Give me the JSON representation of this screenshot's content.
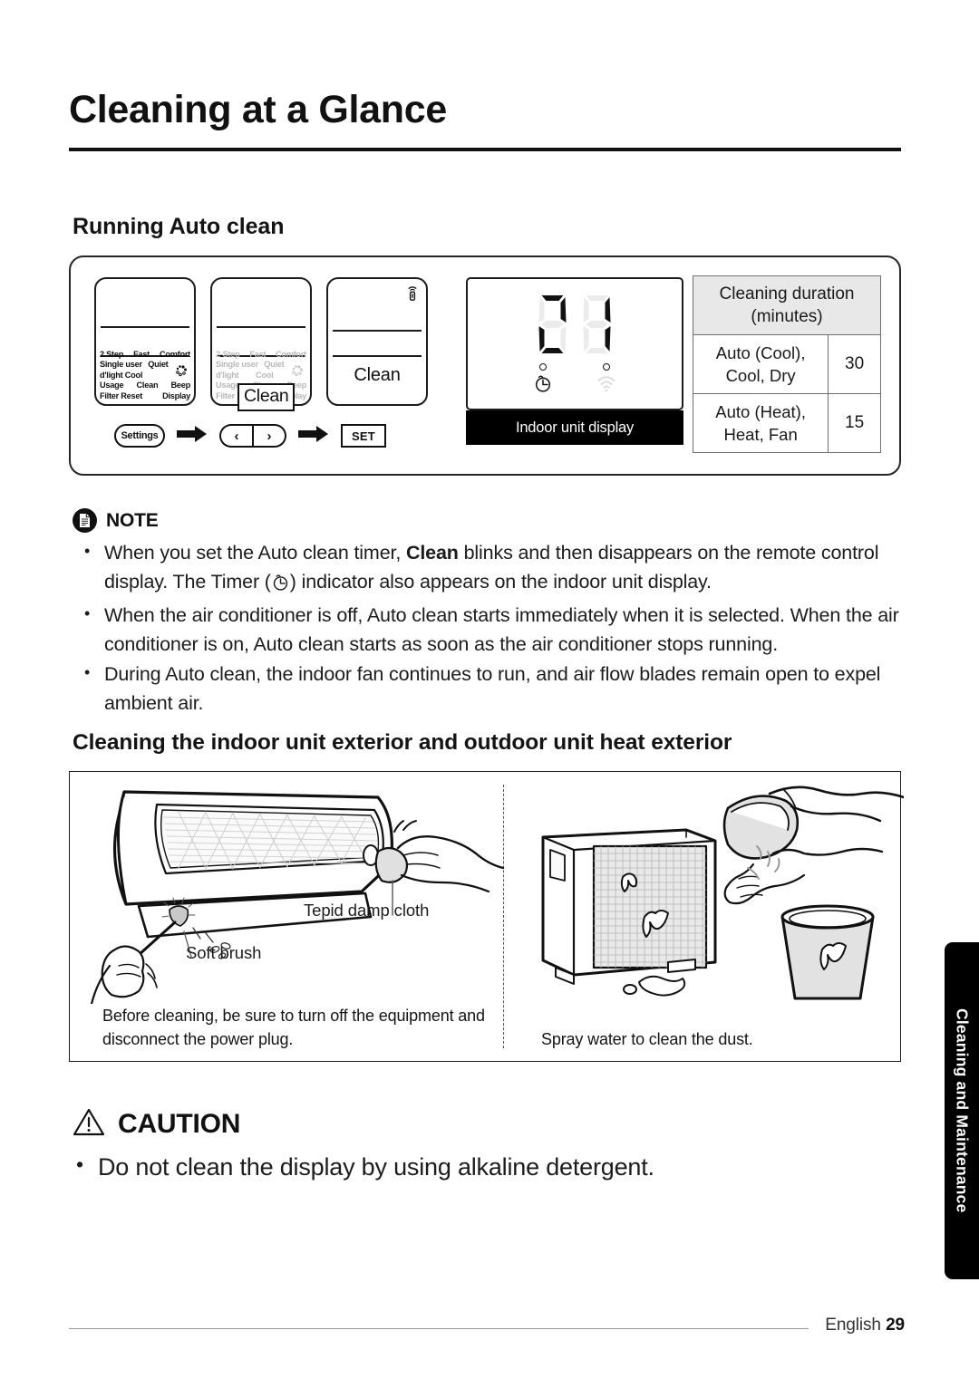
{
  "page_title": "Cleaning at a Glance",
  "sections": {
    "running_auto_clean": {
      "heading": "Running Auto clean",
      "remote_screens": [
        {
          "state": "active",
          "rows": [
            [
              "2 Step",
              "Fast",
              "Comfort"
            ],
            [
              "Single user",
              "Quiet",
              ""
            ],
            [
              "d'light Cool",
              "",
              ""
            ],
            [
              "Usage",
              "Clean",
              "Beep"
            ],
            [
              "Filter Reset",
              "",
              "Display"
            ]
          ]
        },
        {
          "state": "dimmed",
          "rows": [
            [
              "2-Step",
              "Fast",
              "Comfort"
            ],
            [
              "Single user",
              "Quiet",
              ""
            ],
            [
              "d'light",
              "Cool",
              ""
            ],
            [
              "Usage",
              "Clean",
              "Beep"
            ],
            [
              "Filter Reset",
              "",
              "Display"
            ]
          ],
          "highlight_badge": "Clean"
        },
        {
          "state": "result",
          "display_text": "Clean",
          "corner_icon": "signal-transmit-icon"
        }
      ],
      "flow_buttons": [
        {
          "name": "settings-button",
          "label": "Settings",
          "shape": "oval"
        },
        {
          "name": "flow-arrow-1",
          "label": "",
          "shape": "arrow"
        },
        {
          "name": "prev-button",
          "label": "‹",
          "shape": "pill-left"
        },
        {
          "name": "next-button",
          "label": "›",
          "shape": "pill-right"
        },
        {
          "name": "flow-arrow-2",
          "label": "",
          "shape": "arrow"
        },
        {
          "name": "set-button",
          "label": "SET",
          "shape": "rect"
        }
      ],
      "indoor_unit_display": {
        "caption": "Indoor unit display",
        "indicators": [
          {
            "name": "timer-indicator",
            "dot": true,
            "icon": "timer-icon",
            "active": true
          },
          {
            "name": "wifi-indicator",
            "dot": true,
            "icon": "wifi-icon",
            "active": false
          }
        ]
      },
      "duration_table": {
        "header": "Cleaning duration\n(minutes)",
        "header_line1": "Cleaning duration",
        "header_line2": "(minutes)",
        "rows": [
          {
            "mode_line1": "Auto (Cool),",
            "mode_line2": "Cool, Dry",
            "minutes": "30"
          },
          {
            "mode_line1": "Auto (Heat),",
            "mode_line2": "Heat, Fan",
            "minutes": "15"
          }
        ]
      }
    },
    "note": {
      "label": "NOTE",
      "icon": "document-icon",
      "bullets": [
        {
          "part1": "When you set the Auto clean timer, ",
          "bold": "Clean",
          "part2": " blinks and then disappears on the remote control display. The Timer (",
          "icon": "timer-icon",
          "part3": ") indicator also appears on the indoor unit display."
        },
        {
          "text": "When the air conditioner is off, Auto clean starts immediately when it is selected. When the air conditioner is on, Auto clean starts as soon as the air conditioner stops running."
        },
        {
          "text": "During Auto clean, the indoor fan continues to run, and air flow blades remain open to expel ambient air."
        }
      ]
    },
    "cleaning_exterior": {
      "heading": "Cleaning the indoor unit exterior and outdoor unit heat exterior",
      "left_panel": {
        "label_cloth": "Tepid damp cloth",
        "label_brush": "Soft brush",
        "caption": "Before cleaning, be sure to turn off the equipment and disconnect the power plug."
      },
      "right_panel": {
        "caption": "Spray water to clean the dust."
      }
    },
    "caution": {
      "label": "CAUTION",
      "icon": "warning-triangle-icon",
      "text": "Do not clean the display by using alkaline detergent."
    }
  },
  "side_tab": {
    "label": "Cleaning and Maintenance"
  },
  "footer": {
    "language": "English",
    "page_number": "29"
  },
  "colors": {
    "ink": "#111111",
    "table_header_bg": "#e8e8e8",
    "dim_text": "#b8b8b8",
    "black_bar": "#000000"
  }
}
